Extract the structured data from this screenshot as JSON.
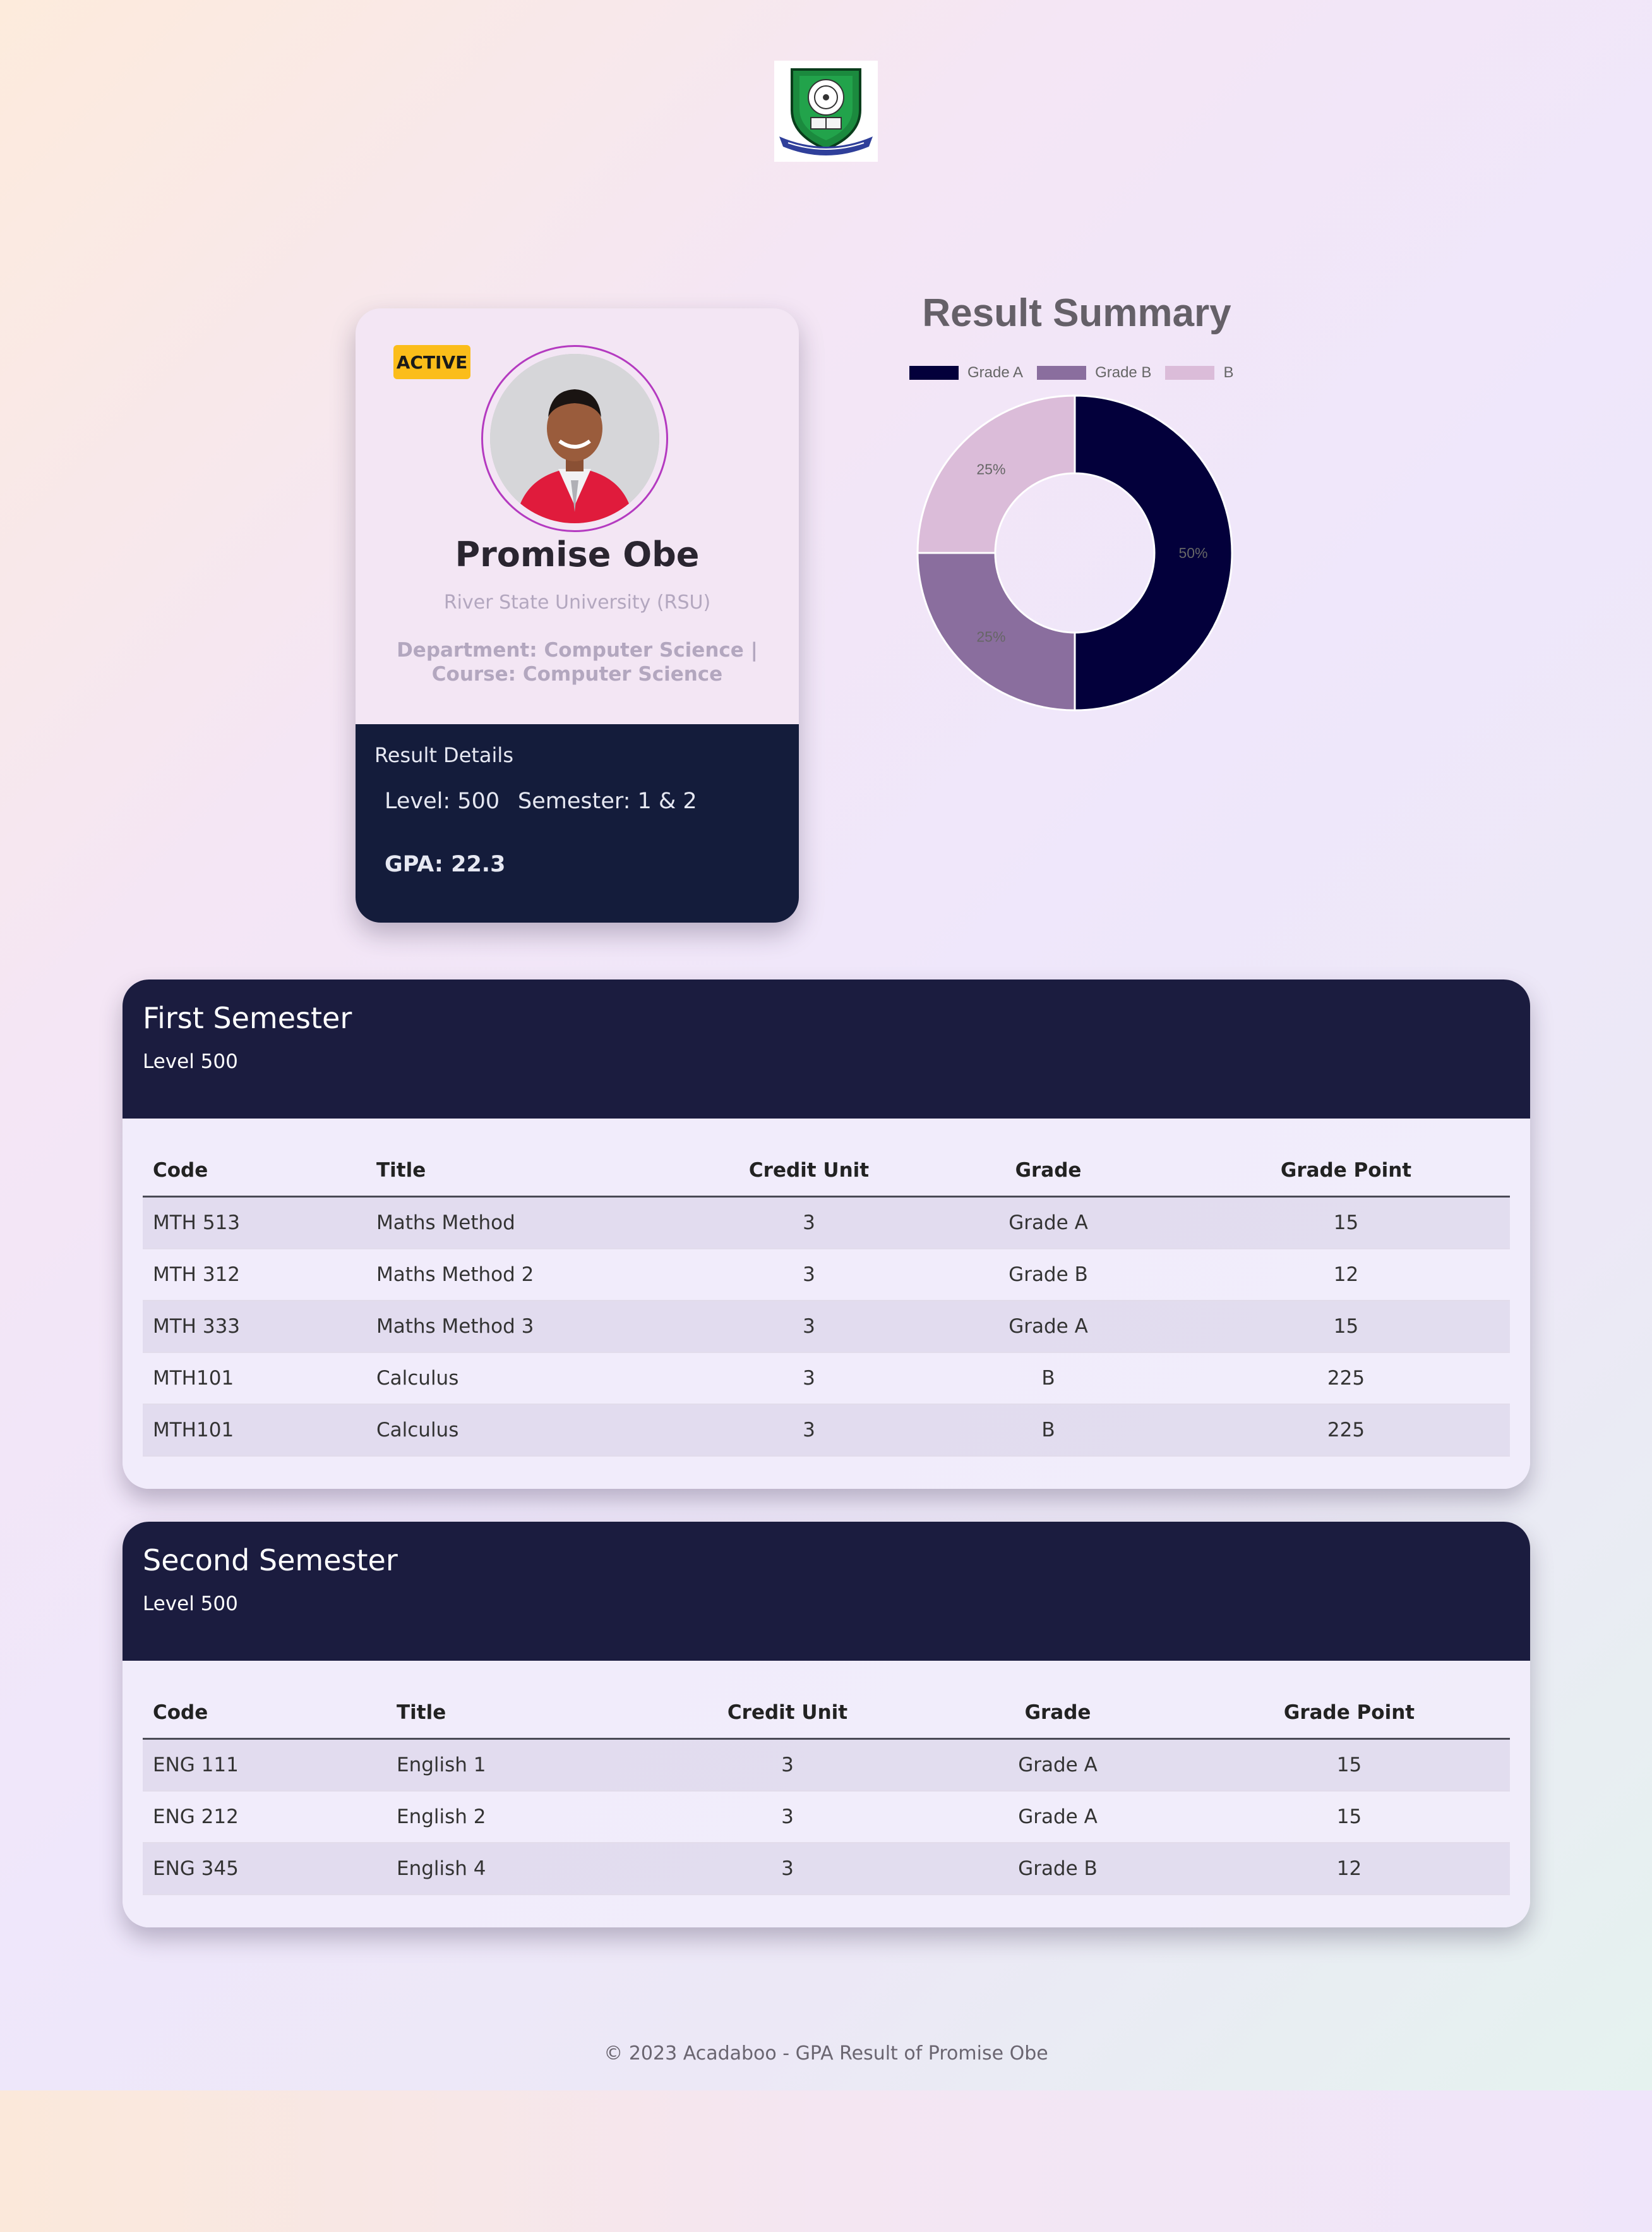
{
  "profile": {
    "status": "ACTIVE",
    "name": "Promise Obe",
    "university": "River State University (RSU)",
    "department": "Department: Computer Science | Course: Computer Science",
    "result_heading": "Result Details",
    "level": "Level: 500",
    "semester": "Semester: 1 & 2",
    "gpa": "GPA: 22.3"
  },
  "chart_data": {
    "type": "pie",
    "title": "Result Summary",
    "series": [
      {
        "name": "Grade A",
        "value": 50,
        "label": "50%",
        "color": "#03003b"
      },
      {
        "name": "Grade B",
        "value": 25,
        "label": "25%",
        "color": "#8a6e9e"
      },
      {
        "name": "B",
        "value": 25,
        "label": "25%",
        "color": "#dbbcd9"
      }
    ],
    "donut": true,
    "legend": "top"
  },
  "semesters": [
    {
      "title": "First Semester",
      "level": "Level 500",
      "headers": [
        "Code",
        "Title",
        "Credit Unit",
        "Grade",
        "Grade Point"
      ],
      "rows": [
        [
          "MTH 513",
          "Maths Method",
          "3",
          "Grade A",
          "15"
        ],
        [
          "MTH 312",
          "Maths Method 2",
          "3",
          "Grade B",
          "12"
        ],
        [
          "MTH 333",
          "Maths Method 3",
          "3",
          "Grade A",
          "15"
        ],
        [
          "MTH101",
          "Calculus",
          "3",
          "B",
          "225"
        ],
        [
          "MTH101",
          "Calculus",
          "3",
          "B",
          "225"
        ]
      ]
    },
    {
      "title": "Second Semester",
      "level": "Level 500",
      "headers": [
        "Code",
        "Title",
        "Credit Unit",
        "Grade",
        "Grade Point"
      ],
      "rows": [
        [
          "ENG 111",
          "English 1",
          "3",
          "Grade A",
          "15"
        ],
        [
          "ENG 212",
          "English 2",
          "3",
          "Grade A",
          "15"
        ],
        [
          "ENG 345",
          "English 4",
          "3",
          "Grade B",
          "12"
        ]
      ]
    }
  ],
  "footer": "© 2023 Acadaboo - GPA Result of Promise Obe"
}
